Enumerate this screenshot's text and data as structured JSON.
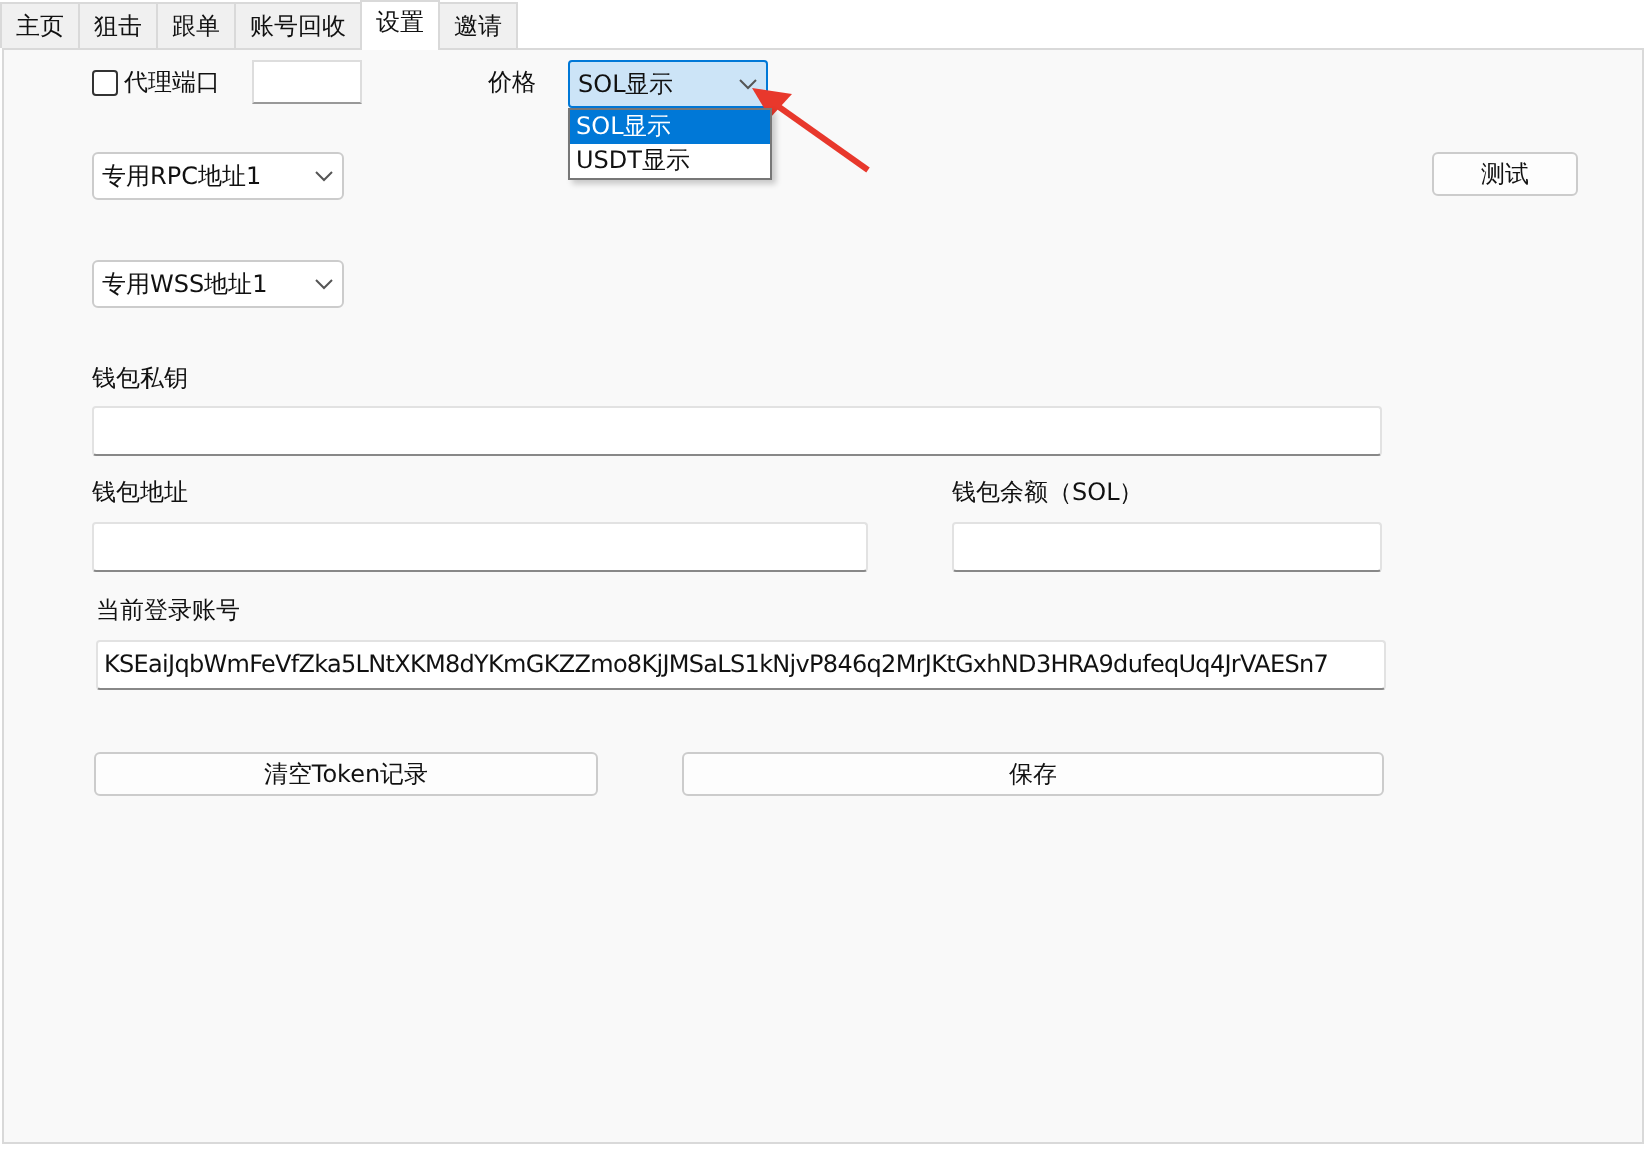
{
  "tabs": [
    {
      "label": "主页",
      "selected": false
    },
    {
      "label": "狙击",
      "selected": false
    },
    {
      "label": "跟单",
      "selected": false
    },
    {
      "label": "账号回收",
      "selected": false
    },
    {
      "label": "设置",
      "selected": true
    },
    {
      "label": "邀请",
      "selected": false
    }
  ],
  "proxy": {
    "label": "代理端口",
    "checked": false
  },
  "price": {
    "label": "价格",
    "value": "SOL显示",
    "expanded": true,
    "options": [
      {
        "label": "SOL显示",
        "selected": true
      },
      {
        "label": "USDT显示",
        "selected": false
      }
    ]
  },
  "rpc": {
    "value": "专用RPC地址1"
  },
  "test_button": "测试",
  "wss": {
    "value": "专用WSS地址1"
  },
  "private_key": {
    "label": "钱包私钥"
  },
  "wallet_address": {
    "label": "钱包地址"
  },
  "wallet_balance": {
    "label": "钱包余额（SOL）"
  },
  "account": {
    "label": "当前登录账号",
    "value": "KSEaiJqbWmFeVfZka5LNtXKM8dYKmGKZZmo8KjJMSaLS1kNjvP846q2MrJKtGxhND3HRA9dufeqUq4JrVAESn7"
  },
  "buttons": [
    "清空Token记录",
    "保存"
  ]
}
